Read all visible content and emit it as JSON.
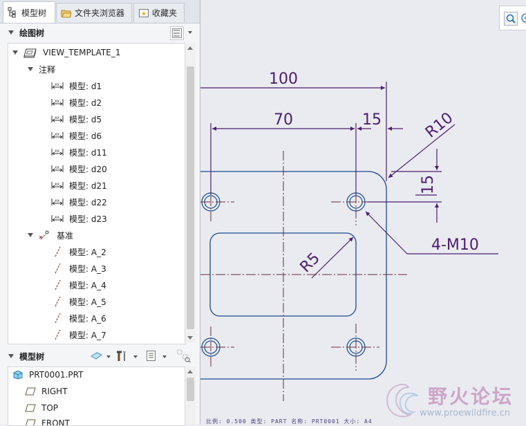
{
  "tabs": [
    {
      "label": "模型树",
      "active": true
    },
    {
      "label": "文件夹浏览器"
    },
    {
      "label": "收藏夹"
    }
  ],
  "drawing_tree": {
    "title": "绘图树",
    "root": "VIEW_TEMPLATE_1",
    "annotations_label": "注释",
    "dimensions": [
      "模型: d1",
      "模型: d2",
      "模型: d5",
      "模型: d6",
      "模型: d11",
      "模型: d20",
      "模型: d21",
      "模型: d22",
      "模型: d23"
    ],
    "datums_label": "基准",
    "axes": [
      "模型: A_2",
      "模型: A_3",
      "模型: A_4",
      "模型: A_5",
      "模型: A_6",
      "模型: A_7"
    ]
  },
  "model_tree": {
    "title": "模型树",
    "items": [
      "PRT0001.PRT",
      "RIGHT",
      "TOP",
      "FRONT"
    ]
  },
  "drawing": {
    "dims": {
      "d100": "100",
      "d70": "70",
      "d15h": "15",
      "r10": "R10",
      "d15v": "15",
      "r5": "R5",
      "hole": "4-M10"
    }
  },
  "status_text": "比例: 0.500   类型: PART   名称: PRT0001   大小: A4",
  "watermark": {
    "title": "野火论坛",
    "url": "www.proewildfire.cn"
  },
  "colors": {
    "dim": "#4b1d6e",
    "part": "#1a4a8c",
    "center": "#6a2a3a",
    "panel": "#f4f5f7",
    "canvas": "#e9ebf0"
  }
}
